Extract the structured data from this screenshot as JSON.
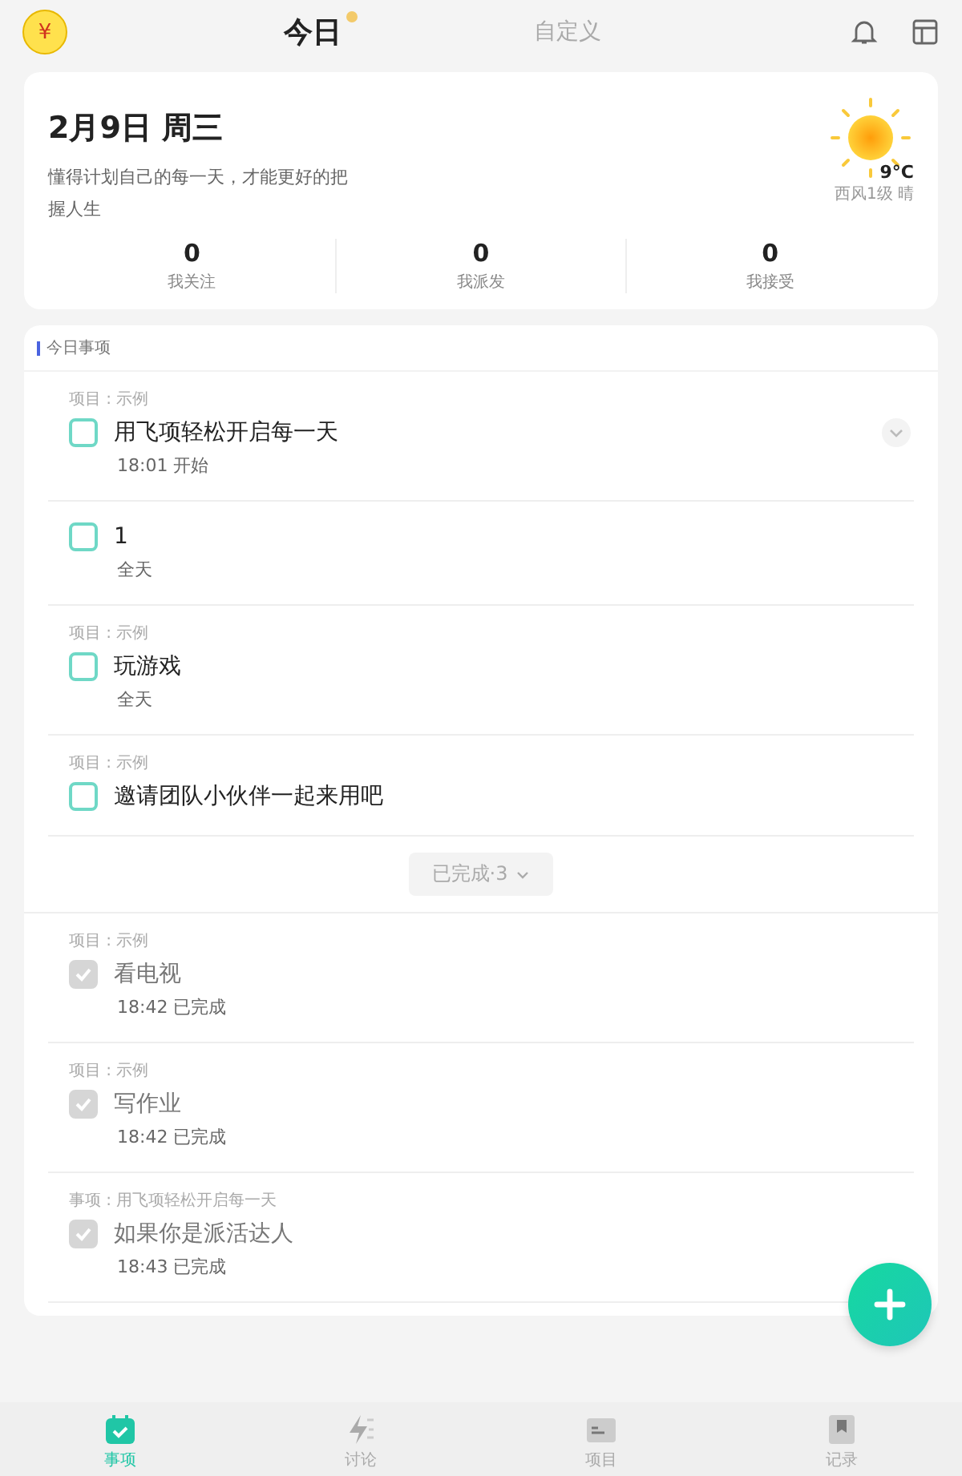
{
  "header": {
    "coin": "¥",
    "tabs": [
      {
        "label": "今日",
        "selected": true
      },
      {
        "label": "自定义",
        "selected": false
      }
    ]
  },
  "summary": {
    "date": "2月9日 周三",
    "motto": "懂得计划自己的每一天，才能更好的把握人生",
    "temperature": "9°C",
    "weather": "西风1级 晴",
    "stats": [
      {
        "value": "0",
        "label": "我关注"
      },
      {
        "value": "0",
        "label": "我派发"
      },
      {
        "value": "0",
        "label": "我接受"
      }
    ]
  },
  "list": {
    "title": "今日事项",
    "tasks": [
      {
        "project": "项目 : 示例",
        "title": "用飞项轻松开启每一天",
        "time": "18:01 开始",
        "checked": false,
        "expandable": true
      },
      {
        "title": "1",
        "time": "全天",
        "checked": false
      },
      {
        "project": "项目 : 示例",
        "title": "玩游戏",
        "time": "全天",
        "checked": false
      },
      {
        "project": "项目 : 示例",
        "title": "邀请团队小伙伴一起来用吧",
        "checked": false
      }
    ],
    "completed_toggle": "已完成·3",
    "completed": [
      {
        "project": "项目 : 示例",
        "title": "看电视",
        "time": "18:42 已完成",
        "checked": true
      },
      {
        "project": "项目 : 示例",
        "title": "写作业",
        "time": "18:42 已完成",
        "checked": true
      },
      {
        "project": "事项 : 用飞项轻松开启每一天",
        "title": "如果你是派活达人",
        "time": "18:43 已完成",
        "checked": true
      }
    ]
  },
  "nav": [
    {
      "label": "事项",
      "selected": true
    },
    {
      "label": "讨论",
      "selected": false
    },
    {
      "label": "项目",
      "selected": false
    },
    {
      "label": "记录",
      "selected": false
    }
  ]
}
